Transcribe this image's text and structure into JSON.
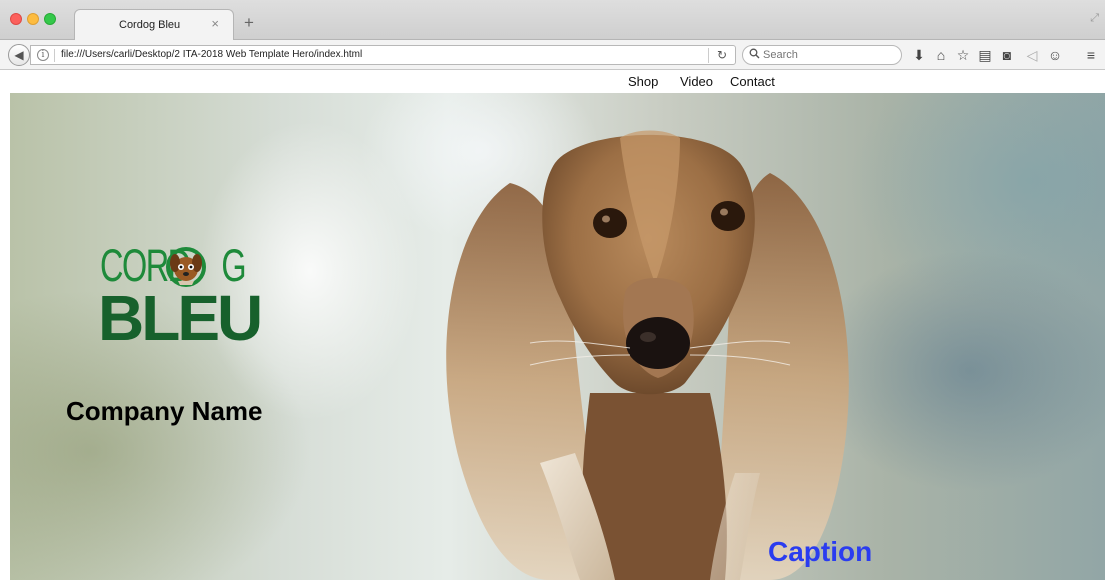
{
  "browser": {
    "tab_title": "Cordog Bleu",
    "tab_close": "×",
    "new_tab": "+",
    "url": "file:///Users/carli/Desktop/2 ITA-2018 Web Template Hero/index.html",
    "search_placeholder": "Search",
    "icons": [
      "back-icon",
      "info-icon",
      "reload-icon",
      "search-icon",
      "download-icon",
      "home-icon",
      "bookmark-star-icon",
      "reading-list-icon",
      "pocket-icon",
      "share-icon",
      "chat-icon",
      "menu-icon"
    ]
  },
  "page": {
    "nav": [
      {
        "label": "Shop"
      },
      {
        "label": "Video"
      },
      {
        "label": "Contact"
      }
    ],
    "logo": {
      "top_text": "CORD",
      "top_text_end": "G",
      "bottom_text": "BLEU",
      "colors": {
        "light_green": "#1e8a3a",
        "dark_green": "#17612c"
      }
    },
    "company_name": "Company Name",
    "caption": "Caption",
    "colors": {
      "caption": "#2a3cf0"
    }
  }
}
